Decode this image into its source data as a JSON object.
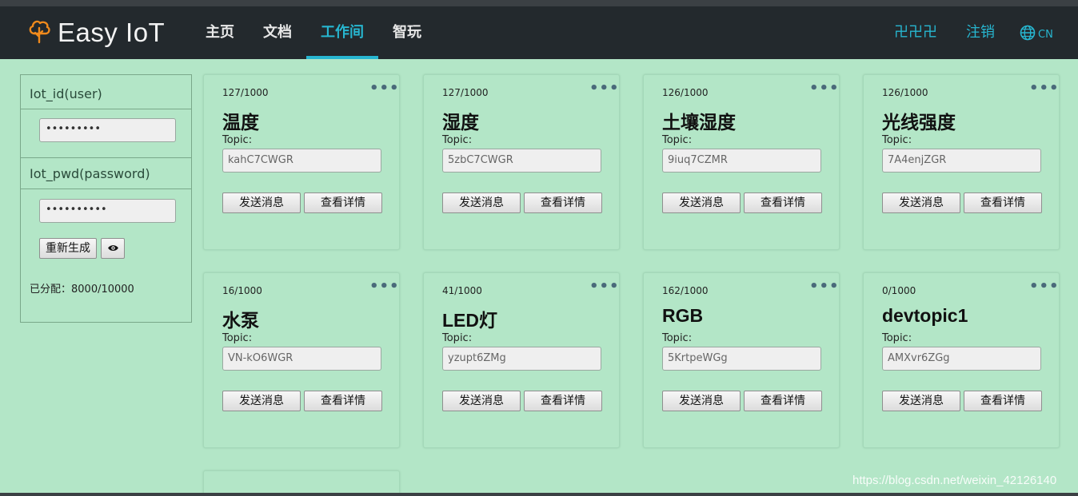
{
  "header": {
    "brand": "Easy IoT",
    "nav": [
      {
        "label": "主页"
      },
      {
        "label": "文档"
      },
      {
        "label": "工作间"
      },
      {
        "label": "智玩"
      }
    ],
    "user": "卍卍卍",
    "logout": "注销",
    "lang": "CN",
    "accent_color": "#27b6d0"
  },
  "left_panel": {
    "id_label": "Iot_id(user)",
    "id_value": "•••••••••",
    "pwd_label": "Iot_pwd(password)",
    "pwd_value": "••••••••••",
    "regen_label": "重新生成",
    "eye_icon": "👁",
    "allocated": "已分配：8000/10000"
  },
  "cards": [
    {
      "count": "127/1000",
      "name": "温度",
      "topic_label": "Topic:",
      "topic": "kahC7CWGR",
      "send": "发送消息",
      "detail": "查看详情"
    },
    {
      "count": "127/1000",
      "name": "湿度",
      "topic_label": "Topic:",
      "topic": "5zbC7CWGR",
      "send": "发送消息",
      "detail": "查看详情"
    },
    {
      "count": "126/1000",
      "name": "土壤湿度",
      "topic_label": "Topic:",
      "topic": "9iuq7CZMR",
      "send": "发送消息",
      "detail": "查看详情"
    },
    {
      "count": "126/1000",
      "name": "光线强度",
      "topic_label": "Topic:",
      "topic": "7A4enjZGR",
      "send": "发送消息",
      "detail": "查看详情"
    },
    {
      "count": "16/1000",
      "name": "水泵",
      "topic_label": "Topic:",
      "topic": "VN-kO6WGR",
      "send": "发送消息",
      "detail": "查看详情"
    },
    {
      "count": "41/1000",
      "name": "LED灯",
      "topic_label": "Topic:",
      "topic": "yzupt6ZMg",
      "send": "发送消息",
      "detail": "查看详情"
    },
    {
      "count": "162/1000",
      "name": "RGB",
      "topic_label": "Topic:",
      "topic": "5KrtpeWGg",
      "send": "发送消息",
      "detail": "查看详情"
    },
    {
      "count": "0/1000",
      "name": "devtopic1",
      "topic_label": "Topic:",
      "topic": "AMXvr6ZGg",
      "send": "发送消息",
      "detail": "查看详情"
    }
  ],
  "watermark": "https://blog.csdn.net/weixin_42126140"
}
